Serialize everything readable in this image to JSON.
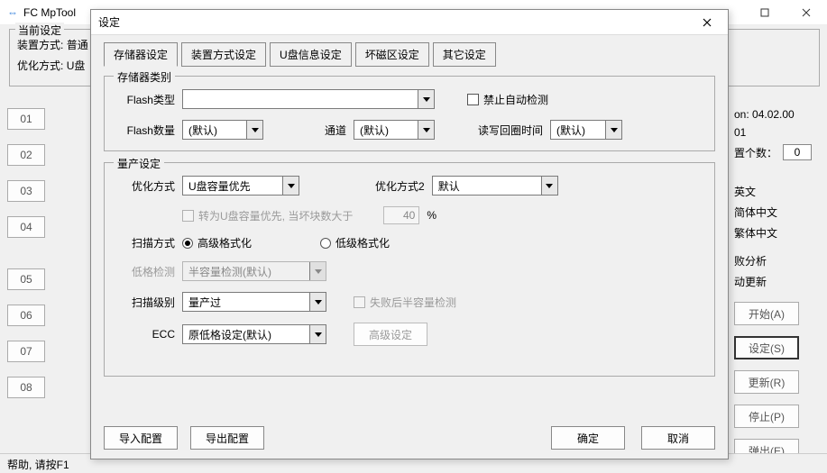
{
  "mainWindow": {
    "title": "FC MpTool",
    "currentSettings": {
      "title": "当前设定",
      "mountLabel": "装置方式:",
      "mountValue": "普通",
      "optLabel": "优化方式:",
      "optValue": "U盘"
    },
    "slots": [
      "01",
      "02",
      "03",
      "04",
      "05",
      "06",
      "07",
      "08"
    ],
    "right": {
      "version": "on: 04.02.00",
      "sub": "01",
      "countLabel": "置个数：",
      "countValue": "0",
      "langs": [
        "英文",
        "简体中文",
        "繁体中文"
      ],
      "links": [
        "败分析",
        "动更新"
      ],
      "buttons": {
        "start": "开始(A)",
        "settings": "设定(S)",
        "refresh": "更新(R)",
        "stop": "停止(P)",
        "exit": "弹出(E)"
      }
    },
    "status": "帮助, 请按F1"
  },
  "modal": {
    "title": "设定",
    "tabs": [
      "存储器设定",
      "装置方式设定",
      "U盘信息设定",
      "坏磁区设定",
      "其它设定"
    ],
    "group1": {
      "title": "存储器类别",
      "flashTypeLabel": "Flash类型",
      "flashTypeValue": "",
      "disableAuto": "禁止自动检测",
      "flashCountLabel": "Flash数量",
      "flashCountValue": "(默认)",
      "channelLabel": "通道",
      "channelValue": "(默认)",
      "rwLabel": "读写回圈时间",
      "rwValue": "(默认)"
    },
    "group2": {
      "title": "量产设定",
      "optLabel": "优化方式",
      "optValue": "U盘容量优先",
      "opt2Label": "优化方式2",
      "opt2Value": "默认",
      "toUdisk": "转为U盘容量优先, 当坏块数大于",
      "badBlock": "40",
      "percent": "%",
      "scanModeLabel": "扫描方式",
      "scanHigh": "高级格式化",
      "scanLow": "低级格式化",
      "lowDetectLabel": "低格检测",
      "lowDetectValue": "半容量检测(默认)",
      "scanLevelLabel": "扫描级别",
      "scanLevelValue": "量产过",
      "failHalf": "失败后半容量检测",
      "eccLabel": "ECC",
      "eccValue": "原低格设定(默认)",
      "advBtn": "高级设定"
    },
    "footer": {
      "import": "导入配置",
      "export": "导出配置",
      "ok": "确定",
      "cancel": "取消"
    }
  }
}
